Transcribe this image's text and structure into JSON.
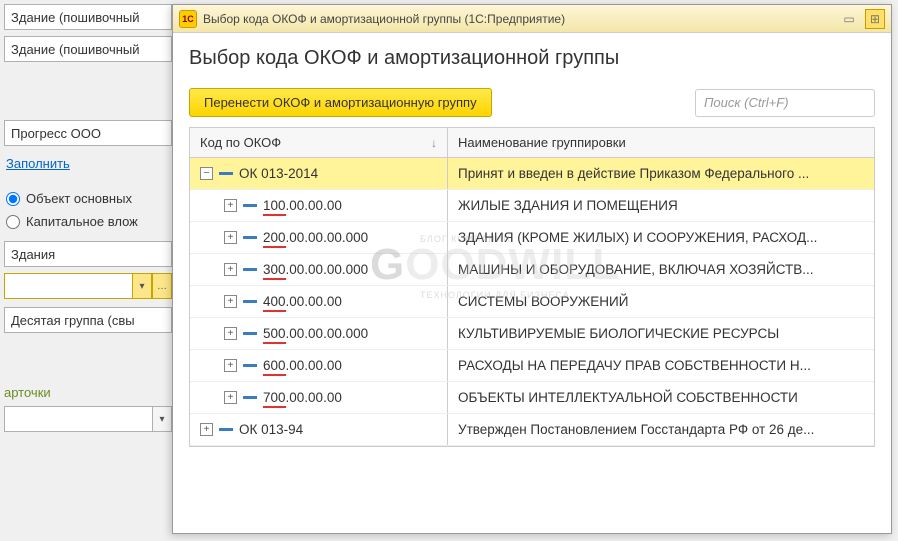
{
  "left": {
    "field1": "Здание (пошивочный",
    "field2": "Здание (пошивочный",
    "field3": "Прогресс ООО",
    "fill_link": "Заполнить",
    "radio1": "Объект основных",
    "radio2": "Капитальное влож",
    "field4": "Здания",
    "field5": "Десятая группа (свы",
    "tab_label": "арточки"
  },
  "titlebar": {
    "app": "1С",
    "text": "Выбор кода ОКОФ и амортизационной группы  (1С:Предприятие)"
  },
  "heading": "Выбор кода ОКОФ и амортизационной группы",
  "toolbar": {
    "transfer_btn": "Перенести ОКОФ и амортизационную группу",
    "search_placeholder": "Поиск (Ctrl+F)"
  },
  "grid": {
    "header_code": "Код по ОКОФ",
    "header_name": "Наименование группировки",
    "rows": [
      {
        "toggle": "−",
        "indent": 0,
        "prefix": "",
        "code": "ОК 013-2014",
        "name": "Принят и введен в действие Приказом Федерального ...",
        "selected": true
      },
      {
        "toggle": "+",
        "indent": 1,
        "prefix": "100",
        "code": ".00.00.00",
        "name": "ЖИЛЫЕ ЗДАНИЯ И ПОМЕЩЕНИЯ",
        "selected": false
      },
      {
        "toggle": "+",
        "indent": 1,
        "prefix": "200",
        "code": ".00.00.00.000",
        "name": "ЗДАНИЯ (КРОМЕ ЖИЛЫХ) И СООРУЖЕНИЯ, РАСХОД...",
        "selected": false
      },
      {
        "toggle": "+",
        "indent": 1,
        "prefix": "300",
        "code": ".00.00.00.000",
        "name": "МАШИНЫ И ОБОРУДОВАНИЕ, ВКЛЮЧАЯ ХОЗЯЙСТВ...",
        "selected": false
      },
      {
        "toggle": "+",
        "indent": 1,
        "prefix": "400",
        "code": ".00.00.00",
        "name": "СИСТЕМЫ ВООРУЖЕНИЙ",
        "selected": false
      },
      {
        "toggle": "+",
        "indent": 1,
        "prefix": "500",
        "code": ".00.00.00.000",
        "name": "КУЛЬТИВИРУЕМЫЕ БИОЛОГИЧЕСКИЕ РЕСУРСЫ",
        "selected": false
      },
      {
        "toggle": "+",
        "indent": 1,
        "prefix": "600",
        "code": ".00.00.00",
        "name": "РАСХОДЫ НА ПЕРЕДАЧУ ПРАВ СОБСТВЕННОСТИ Н...",
        "selected": false
      },
      {
        "toggle": "+",
        "indent": 1,
        "prefix": "700",
        "code": ".00.00.00",
        "name": "ОБЪЕКТЫ ИНТЕЛЛЕКТУАЛЬНОЙ СОБСТВЕННОСТИ",
        "selected": false
      },
      {
        "toggle": "+",
        "indent": 0,
        "prefix": "",
        "code": "ОК 013-94",
        "name": "Утвержден Постановлением Госстандарта РФ от 26 де...",
        "selected": false
      }
    ]
  },
  "watermark": {
    "brand": "GOODWILL",
    "sub1": "БЛОГ КОМПАНИИ",
    "sub2": "ТЕХНОЛОГИИ ДЛЯ БИЗНЕСА"
  }
}
